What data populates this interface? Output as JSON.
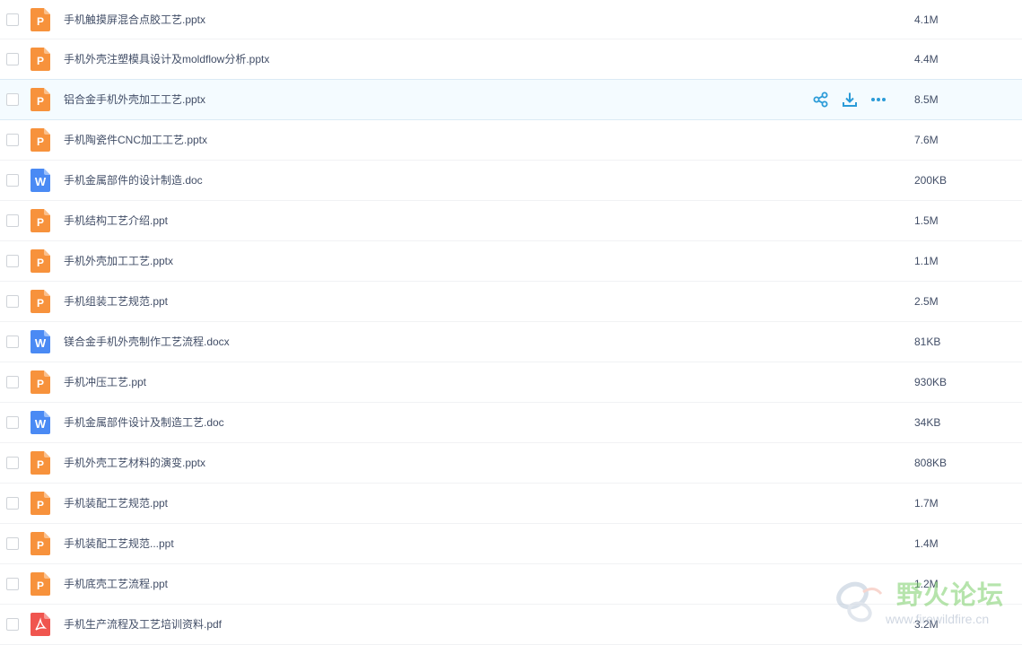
{
  "files": [
    {
      "name": "手机触摸屏混合点胶工艺.pptx",
      "size": "4.1M",
      "type": "ppt"
    },
    {
      "name": "手机外壳注塑模具设计及moldflow分析.pptx",
      "size": "4.4M",
      "type": "ppt"
    },
    {
      "name": "铝合金手机外壳加工工艺.pptx",
      "size": "8.5M",
      "type": "ppt",
      "hover": true
    },
    {
      "name": "手机陶瓷件CNC加工工艺.pptx",
      "size": "7.6M",
      "type": "ppt"
    },
    {
      "name": "手机金属部件的设计制造.doc",
      "size": "200KB",
      "type": "doc"
    },
    {
      "name": "手机结构工艺介绍.ppt",
      "size": "1.5M",
      "type": "ppt"
    },
    {
      "name": "手机外壳加工工艺.pptx",
      "size": "1.1M",
      "type": "ppt"
    },
    {
      "name": "手机组装工艺规范.ppt",
      "size": "2.5M",
      "type": "ppt"
    },
    {
      "name": "镁合金手机外壳制作工艺流程.docx",
      "size": "81KB",
      "type": "doc"
    },
    {
      "name": "手机冲压工艺.ppt",
      "size": "930KB",
      "type": "ppt"
    },
    {
      "name": "手机金属部件设计及制造工艺.doc",
      "size": "34KB",
      "type": "doc"
    },
    {
      "name": "手机外壳工艺材料的演变.pptx",
      "size": "808KB",
      "type": "ppt"
    },
    {
      "name": "手机装配工艺规范.ppt",
      "size": "1.7M",
      "type": "ppt"
    },
    {
      "name": "手机装配工艺规范...ppt",
      "size": "1.4M",
      "type": "ppt"
    },
    {
      "name": "手机底壳工艺流程.ppt",
      "size": "1.2M",
      "type": "ppt"
    },
    {
      "name": "手机生产流程及工艺培训资料.pdf",
      "size": "3.2M",
      "type": "pdf"
    }
  ],
  "icons": {
    "ppt": {
      "letter": "P",
      "color": "#f7923c"
    },
    "doc": {
      "letter": "W",
      "color": "#4a8af4"
    },
    "pdf": {
      "letter": "",
      "color": "#f0554f"
    }
  },
  "actions": [
    "share-icon",
    "download-icon",
    "more-icon"
  ],
  "accent": "#2b9bd8",
  "watermark": {
    "title": "野火论坛",
    "url": "www.firewildfire.cn"
  }
}
